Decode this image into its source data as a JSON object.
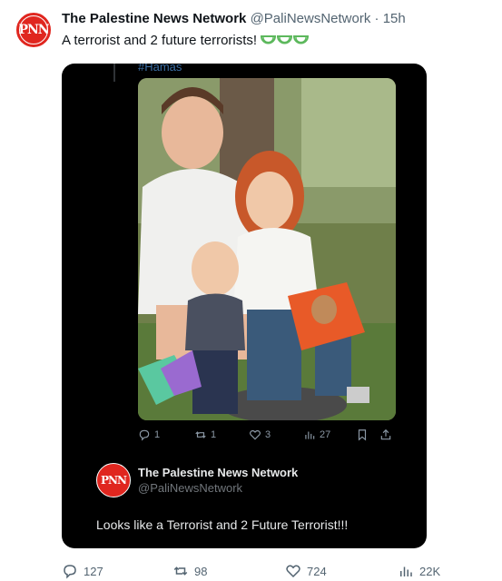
{
  "tweet": {
    "avatar_text": "PNN",
    "display_name": "The Palestine News Network",
    "handle": "@PaliNewsNetwork",
    "separator": "·",
    "time": "15h",
    "text": "A terrorist and 2 future terrorists!",
    "emoji": [
      "watermelon",
      "watermelon",
      "watermelon"
    ]
  },
  "quote": {
    "hashtag": "#Hamas",
    "photo_icon": "family-photo",
    "actions": {
      "replies": "1",
      "retweets": "1",
      "likes": "3",
      "views": "27"
    },
    "author": {
      "avatar_text": "PNN",
      "display_name": "The Palestine News Network",
      "handle": "@PaliNewsNetwork"
    },
    "text": "Looks like a Terrorist and 2 Future Terrorist!!!"
  },
  "actions": {
    "replies": "127",
    "retweets": "98",
    "likes": "724",
    "views": "22K"
  },
  "colors": {
    "brand_red": "#e0261f",
    "emoji_green": "#5cb85c",
    "secondary_text": "#536471"
  }
}
